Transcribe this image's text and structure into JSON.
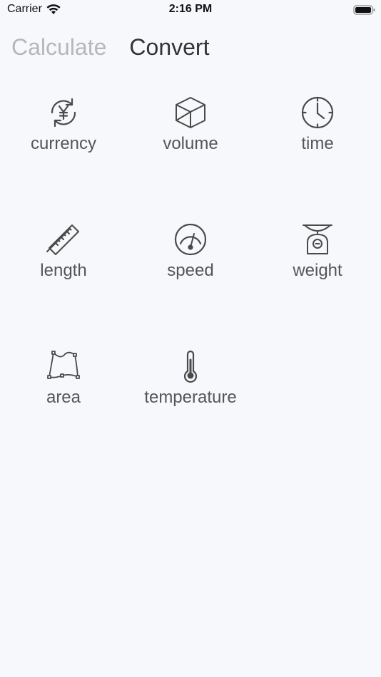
{
  "status_bar": {
    "carrier": "Carrier",
    "time": "2:16 PM"
  },
  "tabs": [
    {
      "label": "Calculate",
      "active": false
    },
    {
      "label": "Convert",
      "active": true
    }
  ],
  "categories": [
    {
      "label": "currency",
      "icon": "currency-exchange-icon"
    },
    {
      "label": "volume",
      "icon": "cube-icon"
    },
    {
      "label": "time",
      "icon": "clock-icon"
    },
    {
      "label": "length",
      "icon": "ruler-icon"
    },
    {
      "label": "speed",
      "icon": "speedometer-icon"
    },
    {
      "label": "weight",
      "icon": "scale-icon"
    },
    {
      "label": "area",
      "icon": "area-shape-icon"
    },
    {
      "label": "temperature",
      "icon": "thermometer-icon"
    }
  ],
  "colors": {
    "background": "#f7f8fc",
    "icon": "#4a4a4a",
    "label": "#555555",
    "tab_inactive": "#b7b7b9",
    "tab_active": "#333333"
  }
}
